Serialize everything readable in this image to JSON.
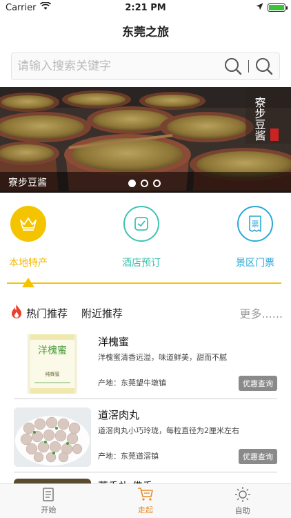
{
  "status_bar": {
    "carrier": "Carrier",
    "time": "2:21 PM"
  },
  "nav": {
    "title": "东莞之旅"
  },
  "search": {
    "placeholder": "请输入搜索关键字"
  },
  "banner": {
    "caption": "寮步豆酱",
    "overlay_text": "寮步豆酱",
    "stamp_text": "东莞",
    "dots_total": 3,
    "dots_active_index": 0
  },
  "categories": [
    {
      "label": "本地特产",
      "icon": "crown-icon",
      "color": "#f5c400"
    },
    {
      "label": "酒店预订",
      "icon": "checkbox-icon",
      "color": "#3cc3b0"
    },
    {
      "label": "景区门票",
      "icon": "ticket-icon",
      "color": "#2aa8d6"
    }
  ],
  "section": {
    "tab_hot": "热门推荐",
    "tab_near": "附近推荐",
    "more": "更多......"
  },
  "items": [
    {
      "title": "洋槐蜜",
      "desc": "洋槐蜜清香远溢，味道鲜美，甜而不腻",
      "origin": "产地：东莞望牛墩镇",
      "button": "优惠查询",
      "bottle_label": "洋槐蜜",
      "bottle_sub": "纯蜂蜜"
    },
    {
      "title": "道滘肉丸",
      "desc": "道滘肉丸小巧玲珑，每粒直径为2厘米左右",
      "origin": "产地：东莞道滘镇",
      "button": "优惠查询"
    },
    {
      "title": "莞香礼·佛香"
    }
  ],
  "tabbar": [
    {
      "label": "开始",
      "icon": "document-icon"
    },
    {
      "label": "走起",
      "icon": "cart-icon"
    },
    {
      "label": "自助",
      "icon": "sun-icon"
    }
  ],
  "colors": {
    "accent": "#f5c400",
    "tab_active": "#e88a2a",
    "button_gray": "#8a8a8a"
  }
}
